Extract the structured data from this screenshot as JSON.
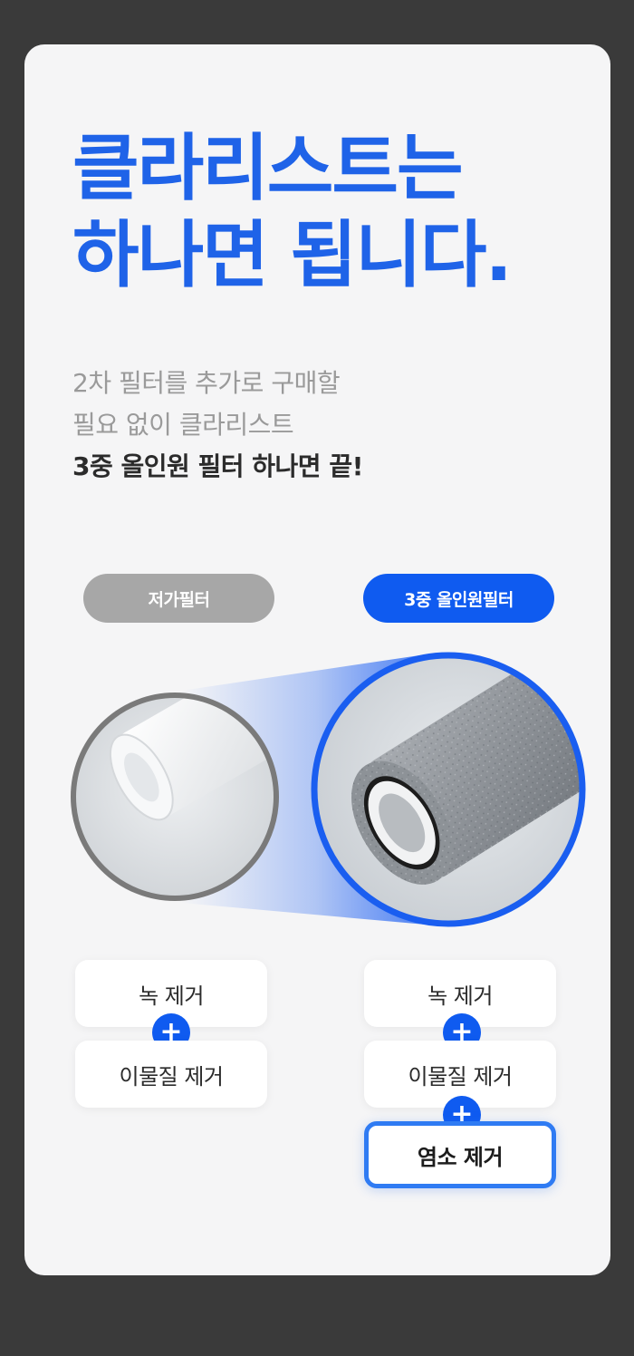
{
  "headline": {
    "line1": "클라리스트는",
    "line2": "하나면 됩니다."
  },
  "subcopy": {
    "line1": "2차 필터를 추가로 구매할",
    "line2": "필요 없이 클라리스트",
    "line3": "3중 올인원 필터 하나면 끝!"
  },
  "compare": {
    "left_label": "저가필터",
    "right_label": "3중 올인원필터"
  },
  "left_features": [
    "녹 제거",
    "이물질 제거"
  ],
  "right_features": [
    "녹 제거",
    "이물질 제거",
    "염소 제거"
  ],
  "plus_symbol": "+",
  "colors": {
    "accent": "#0f5bf0",
    "headline": "#1f63e8",
    "muted_pill": "#a7a7a7",
    "card_bg": "#f5f5f6",
    "page_bg": "#3a3a3a"
  }
}
